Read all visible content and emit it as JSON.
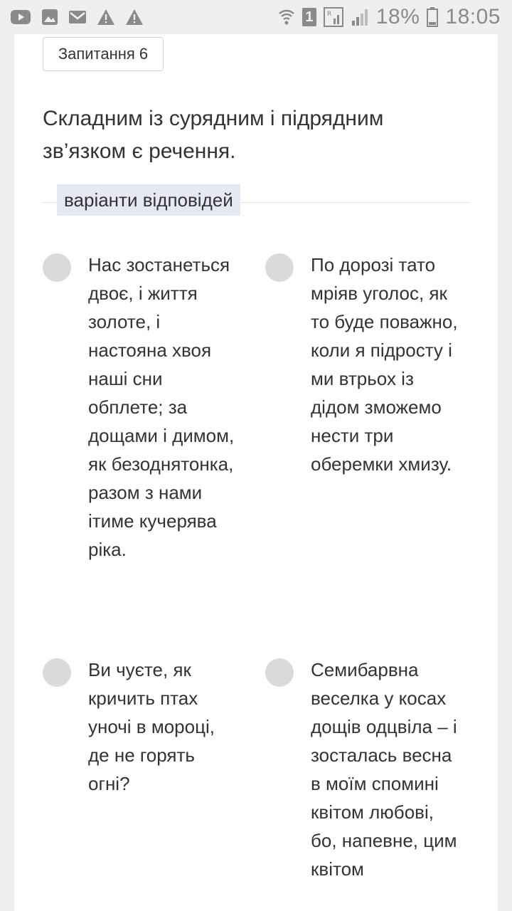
{
  "status_bar": {
    "battery": "18%",
    "time": "18:05",
    "sim_slot": "1"
  },
  "question": {
    "badge": "Запитання 6",
    "text": "Складним із сурядним і підрядним зв’язком є речення.",
    "variants_label": "варіанти відповідей"
  },
  "options": [
    {
      "text": "Нас зостанеться двоє, і життя золоте, і настояна хвоя наші сни обплете; за дощами і димом, як безоднятонка, разом з нами ітиме кучерява ріка."
    },
    {
      "text": "По дорозі тато мріяв уголос, як то буде поважно, коли я підросту і ми втрьох із дідом зможемо нести три оберемки хмизу."
    },
    {
      "text": "Ви чуєте, як кричить птах уночі в мороці, де не горять огні?"
    },
    {
      "text": "Семибарвна веселка у косах дощів одцвіла – і зосталась весна в моїм спомині квітом любові, бо, напевне, цим квітом"
    }
  ],
  "colors": {
    "variants_bg": "#e6e8f4",
    "radio": "#dadada",
    "card": "#ffffff",
    "background": "#efefef"
  }
}
